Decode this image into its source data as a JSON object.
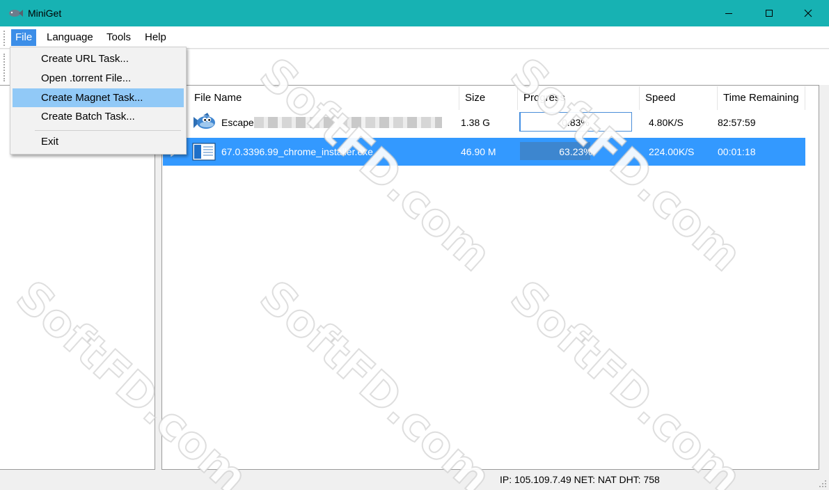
{
  "window": {
    "title": "MiniGet",
    "colors": {
      "titlebar": "#17b2b3",
      "menu_active": "#3c8ee8",
      "selection": "#3399ff",
      "menu_hover": "#91c9f7"
    }
  },
  "menubar": {
    "items": [
      {
        "label": "File"
      },
      {
        "label": "Language"
      },
      {
        "label": "Tools"
      },
      {
        "label": "Help"
      }
    ]
  },
  "file_menu": {
    "items": [
      {
        "label": "Create URL Task..."
      },
      {
        "label": "Open .torrent File..."
      },
      {
        "label": "Create Magnet Task..."
      },
      {
        "label": "Create Batch Task..."
      },
      {
        "label": "Exit"
      }
    ],
    "highlighted": "Create Magnet Task..."
  },
  "task_list": {
    "columns": [
      {
        "label": "File Name"
      },
      {
        "label": "Size"
      },
      {
        "label": "Progress"
      },
      {
        "label": "Speed"
      },
      {
        "label": "Time Remaining"
      }
    ],
    "rows": [
      {
        "icon": "fish-icon",
        "name": "Escape",
        "size": "1.38 G",
        "progress_label": "0.83%",
        "progress": 0.0083,
        "speed": "4.80K/S",
        "time_remaining": "82:57:59",
        "selected": false
      },
      {
        "icon": "exe-file-icon",
        "name": "67.0.3396.99_chrome_installer.exe",
        "size": "46.90 M",
        "progress_label": "63.23%",
        "progress": 0.6323,
        "speed": "224.00K/S",
        "time_remaining": "00:01:18",
        "selected": true
      }
    ]
  },
  "statusbar": {
    "text": "IP: 105.109.7.49 NET: NAT   DHT: 758"
  },
  "watermark": {
    "text": "SoftFD.com"
  }
}
